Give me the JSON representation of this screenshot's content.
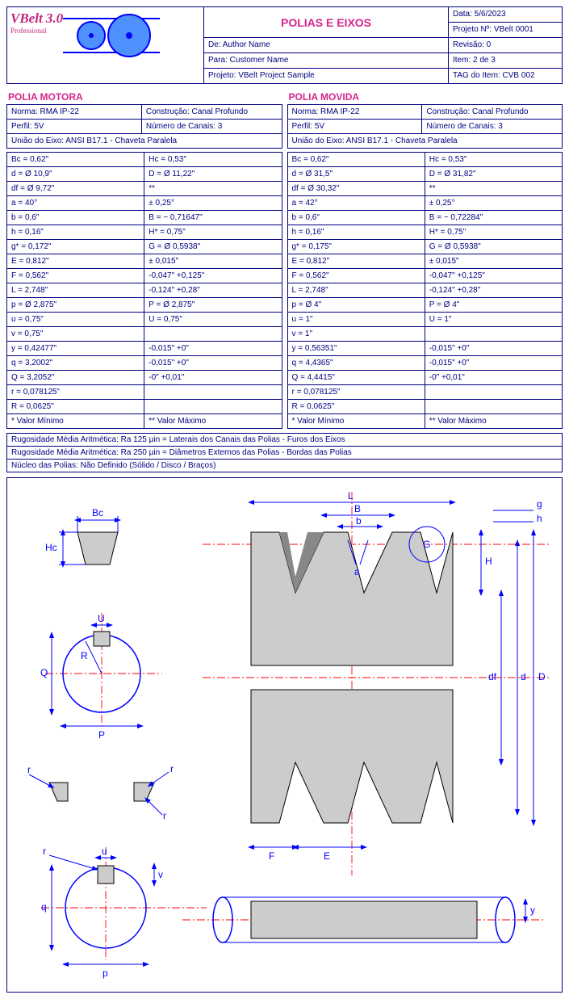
{
  "brand": {
    "name": "VBelt 3.0",
    "subtitle": "Professional"
  },
  "header": {
    "title": "POLIAS E EIXOS",
    "data": "Data:  5/6/2023",
    "projno": "Projeto Nº:  VBelt 0001",
    "de": "De:  Author Name",
    "rev": "Revisão:  0",
    "para": "Para:  Customer Name",
    "item": "Item:  2 de 3",
    "projeto": "Projeto:  VBelt Project Sample",
    "tag": "TAG do Item:  CVB 002"
  },
  "motora": {
    "title": "POLIA MOTORA",
    "norma": "Norma:  RMA IP-22",
    "construcao": "Construção:  Canal Profundo",
    "perfil": "Perfil:  5V",
    "canais": "Número de Canais:  3",
    "uniao": "União do Eixo:  ANSI B17.1 - Chaveta Paralela",
    "rows": [
      [
        "Bc  =  0,62\"",
        "Hc  =  0,53\""
      ],
      [
        "d  =  Ø 10,9\"",
        "D  =  Ø 11,22\""
      ],
      [
        "df  =  Ø 9,72\"",
        "**"
      ],
      [
        "a  =  40°",
        "± 0,25°"
      ],
      [
        "b  =  0,6\"",
        "B  =  ~ 0,71647\""
      ],
      [
        "h  =  0,16\"",
        "H*  =  0,75\""
      ],
      [
        "g*  =  0,172\"",
        "G  =  Ø 0,5938\""
      ],
      [
        "E  =  0,812\"",
        "± 0,015\""
      ],
      [
        "F  =  0,562\"",
        "-0,047\"    +0,125\""
      ],
      [
        "L  =  2,748\"",
        "-0,124\"    +0,28\""
      ],
      [
        "p  =  Ø 2,875\"",
        "P  =  Ø 2,875\""
      ],
      [
        "u  =  0,75\"",
        "U  =  0,75\""
      ],
      [
        "v  =  0,75\"",
        ""
      ],
      [
        "y  =  0,42477\"",
        "-0,015\"    +0\""
      ],
      [
        "q  =  3,2002\"",
        "-0,015\"    +0\""
      ],
      [
        "Q  =  3,2052\"",
        "-0\"    +0,01\""
      ],
      [
        "r  =  0,078125\"",
        ""
      ],
      [
        "R  =  0,0625\"",
        ""
      ],
      [
        "* Valor Mínimo",
        "** Valor Máximo"
      ]
    ]
  },
  "movida": {
    "title": "POLIA MOVIDA",
    "norma": "Norma:  RMA IP-22",
    "construcao": "Construção:  Canal Profundo",
    "perfil": "Perfil:  5V",
    "canais": "Número de Canais:  3",
    "uniao": "União do Eixo:  ANSI B17.1 - Chaveta Paralela",
    "rows": [
      [
        "Bc  =  0,62\"",
        "Hc  =  0,53\""
      ],
      [
        "d  =  Ø 31,5\"",
        "D  =  Ø 31,82\""
      ],
      [
        "df  =  Ø 30,32\"",
        "**"
      ],
      [
        "a  =  42°",
        "± 0,25°"
      ],
      [
        "b  =  0,6\"",
        "B  =  ~ 0,72284\""
      ],
      [
        "h  =  0,16\"",
        "H*  =  0,75\""
      ],
      [
        "g*  =  0,175\"",
        "G  =  Ø 0,5938\""
      ],
      [
        "E  =  0,812\"",
        "± 0,015\""
      ],
      [
        "F  =  0,562\"",
        "-0,047\"    +0,125\""
      ],
      [
        "L  =  2,748\"",
        "-0,124\"    +0,28\""
      ],
      [
        "p  =  Ø 4\"",
        "P  =  Ø 4\""
      ],
      [
        "u  =  1\"",
        "U  =  1\""
      ],
      [
        "v  =  1\"",
        ""
      ],
      [
        "y  =  0,56351\"",
        "-0,015\"    +0\""
      ],
      [
        "q  =  4,4365\"",
        "-0,015\"    +0\""
      ],
      [
        "Q  =  4,4415\"",
        "-0\"    +0,01\""
      ],
      [
        "r  =  0,078125\"",
        ""
      ],
      [
        "R  =  0,0625\"",
        ""
      ],
      [
        "* Valor Mínimo",
        "** Valor Máximo"
      ]
    ]
  },
  "notes": {
    "r1": "Rugosidade Média Aritmética:  Ra 125 µin  =  Laterais dos Canais das Polias - Furos dos Eixos",
    "r2": "Rugosidade Média Aritmética:  Ra 250 µin  =  Diâmetros Externos das Polias - Bordas das Polias",
    "r3": "Núcleo das Polias:  Não Definido (Sólido / Disco / Braços)"
  },
  "dim": {
    "Bc": "Bc",
    "Hc": "Hc",
    "U": "U",
    "R": "R",
    "Q": "Q",
    "P": "P",
    "r": "r",
    "u": "u",
    "v": "v",
    "q": "q",
    "p": "p",
    "L": "L",
    "B": "B",
    "b": "b",
    "a": "a",
    "g": "g",
    "h": "h",
    "G": "G",
    "H": "H",
    "df": "df",
    "d": "d",
    "D": "D",
    "F": "F",
    "E": "E",
    "y": "y"
  }
}
